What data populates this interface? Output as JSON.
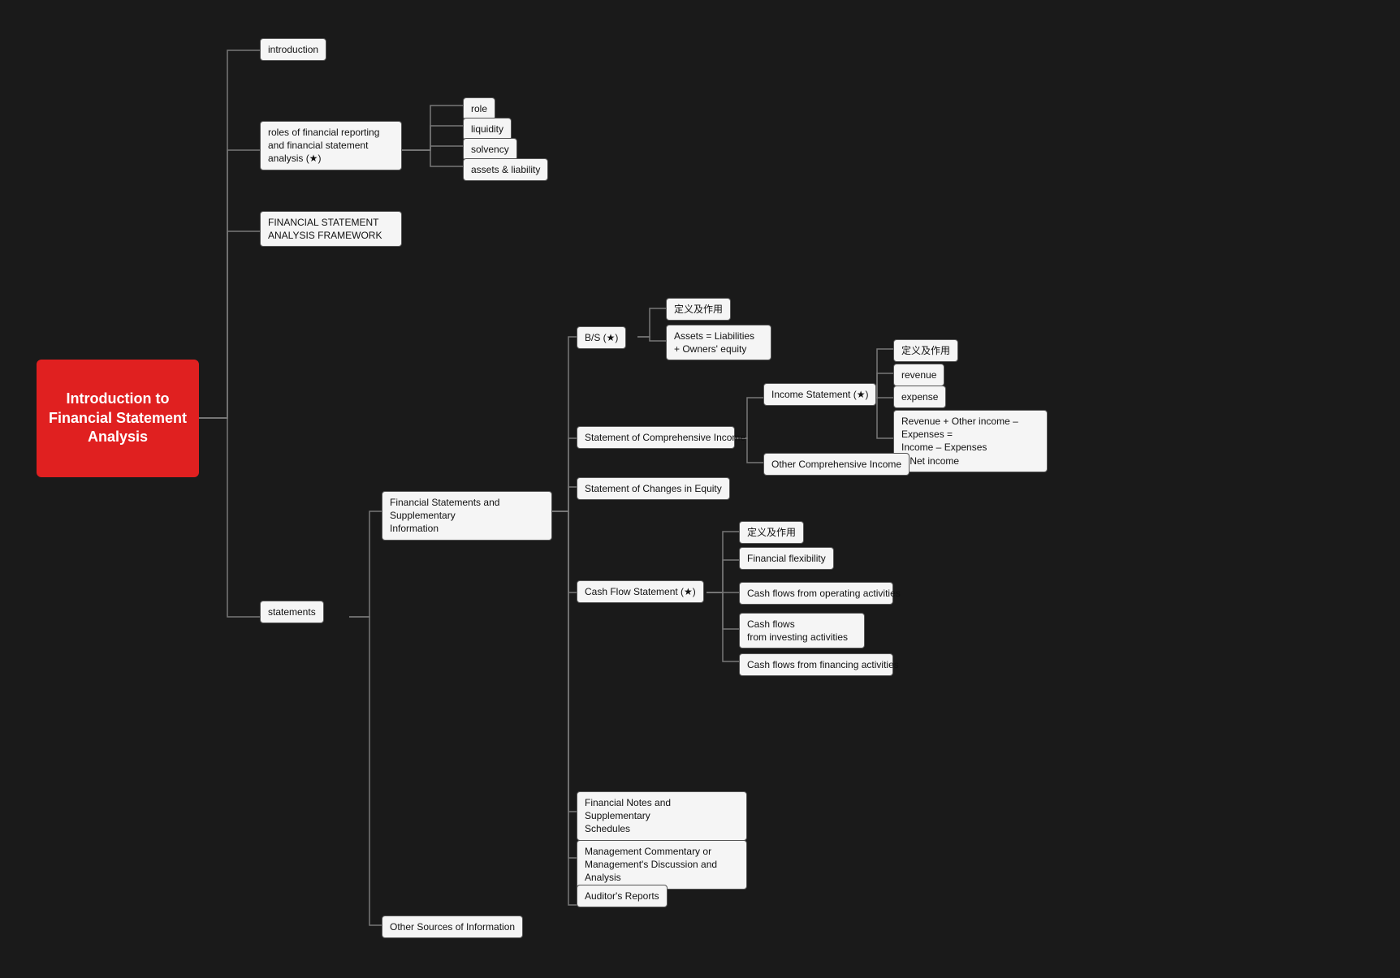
{
  "root": {
    "label": "Introduction to Financial Statement Analysis"
  },
  "nodes": {
    "introduction": {
      "label": "introduction"
    },
    "roles": {
      "label": "roles of financial reporting\nand financial statement\nanalysis (★)"
    },
    "role": {
      "label": "role"
    },
    "liquidity": {
      "label": "liquidity"
    },
    "solvency": {
      "label": "solvency"
    },
    "assets_liability": {
      "label": "assets & liability"
    },
    "framework": {
      "label": "FINANCIAL STATEMENT\nANALYSIS FRAMEWORK"
    },
    "statements": {
      "label": "statements"
    },
    "fin_statements_supp": {
      "label": "Financial Statements and Supplementary\nInformation"
    },
    "other_sources": {
      "label": "Other Sources of Information"
    },
    "bs": {
      "label": "B/S (★)"
    },
    "bs_def": {
      "label": "定义及作用"
    },
    "bs_eq": {
      "label": "Assets = Liabilities\n+ Owners' equity"
    },
    "comp_income": {
      "label": "Statement of Comprehensive Income"
    },
    "income_stmt": {
      "label": "Income Statement (★)"
    },
    "income_def": {
      "label": "定义及作用"
    },
    "revenue": {
      "label": "revenue"
    },
    "expense": {
      "label": "expense"
    },
    "income_formula": {
      "label": "Revenue + Other income – Expenses =\nIncome – Expenses\n= Net income"
    },
    "other_comp_income": {
      "label": "Other Comprehensive Income"
    },
    "changes_equity": {
      "label": "Statement of Changes in Equity"
    },
    "cash_flow": {
      "label": "Cash Flow Statement (★)"
    },
    "cash_def": {
      "label": "定义及作用"
    },
    "fin_flexibility": {
      "label": "Financial flexibility"
    },
    "cash_operating": {
      "label": "Cash flows from operating activities"
    },
    "cash_investing": {
      "label": "Cash flows\nfrom investing activities"
    },
    "cash_financing": {
      "label": "Cash flows from financing activities"
    },
    "fin_notes": {
      "label": "Financial Notes and Supplementary\nSchedules"
    },
    "mgmt_commentary": {
      "label": "Management Commentary or\nManagement's Discussion and Analysis"
    },
    "auditor": {
      "label": "Auditor's Reports"
    }
  }
}
